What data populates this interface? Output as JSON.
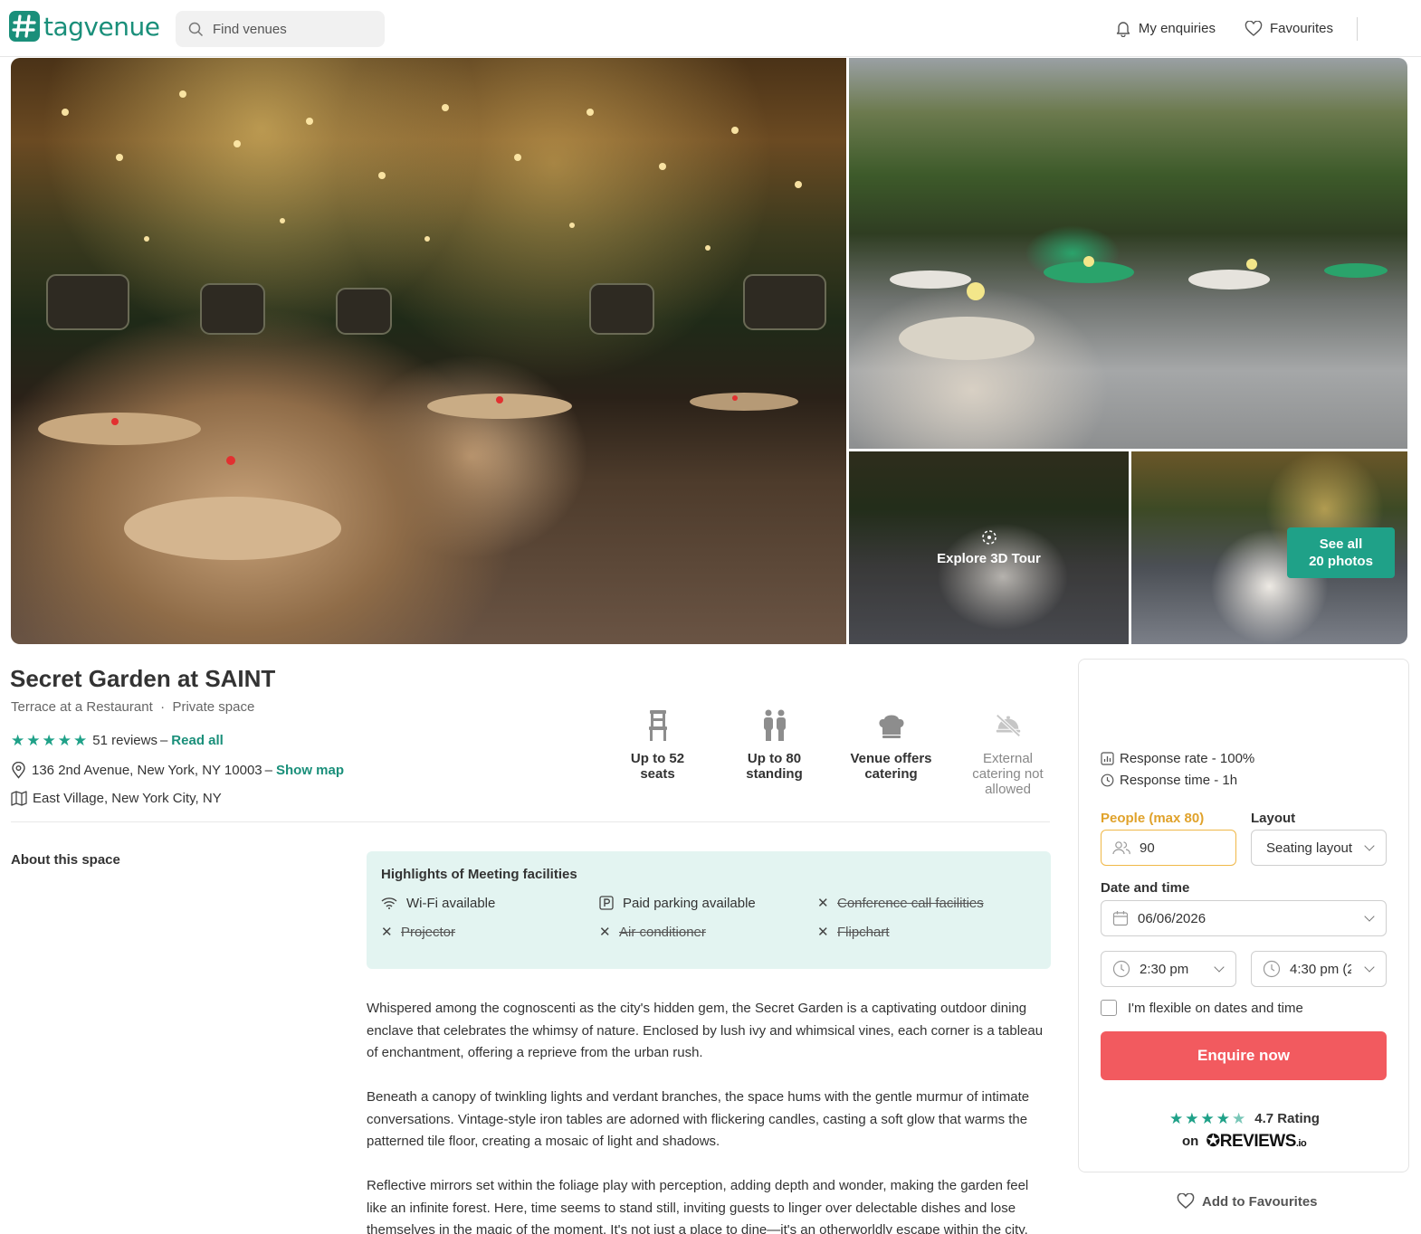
{
  "header": {
    "logo_text": "tagvenue",
    "search_placeholder": "Find venues",
    "nav": {
      "enquiries": "My enquiries",
      "favourites": "Favourites"
    }
  },
  "gallery": {
    "tour_label": "Explore 3D Tour",
    "see_all_line1": "See all",
    "see_all_line2": "20 photos"
  },
  "venue": {
    "title": "Secret Garden at SAINT",
    "type": "Terrace at a Restaurant",
    "space": "Private space",
    "rating_stars": 5,
    "reviews_count": "51 reviews",
    "reviews_sep": "–",
    "read_all": "Read all",
    "address": "136 2nd Avenue, New York, NY 10003",
    "address_sep": "–",
    "show_map": "Show map",
    "area": "East Village, New York City, NY"
  },
  "features": [
    {
      "icon": "chair-icon",
      "line1": "Up to 52",
      "line2": "seats",
      "line3": ""
    },
    {
      "icon": "standing-people-icon",
      "line1": "Up to 80",
      "line2": "standing",
      "line3": ""
    },
    {
      "icon": "chef-hat-icon",
      "line1": "Venue offers",
      "line2": "catering",
      "line3": ""
    },
    {
      "icon": "no-catering-icon",
      "line1": "External",
      "line2": "catering not",
      "line3": "allowed"
    }
  ],
  "about_label": "About this space",
  "highlights": {
    "title": "Highlights of Meeting facilities",
    "items": [
      {
        "label": "Wi-Fi available",
        "available": true,
        "icon": "wifi-icon"
      },
      {
        "label": "Paid parking available",
        "available": true,
        "icon": "parking-icon"
      },
      {
        "label": "Conference call facilities",
        "available": false,
        "icon": "x-icon"
      },
      {
        "label": "Projector",
        "available": false,
        "icon": "x-icon"
      },
      {
        "label": "Air conditioner",
        "available": false,
        "icon": "x-icon"
      },
      {
        "label": "Flipchart",
        "available": false,
        "icon": "x-icon"
      }
    ]
  },
  "description": {
    "p1": "Whispered among the cognoscenti as the city's hidden gem, the Secret Garden is a captivating outdoor dining enclave that celebrates the whimsy of nature. Enclosed by lush ivy and whimsical vines, each corner is a tableau of enchantment, offering a reprieve from the urban rush.",
    "p2": "Beneath a canopy of twinkling lights and verdant branches, the space hums with the gentle murmur of intimate conversations. Vintage-style iron tables are adorned with flickering candles, casting a soft glow that warms the patterned tile floor, creating a mosaic of light and shadows.",
    "p3": "Reflective mirrors set within the foliage play with perception, adding depth and wonder, making the garden feel like an infinite forest. Here, time seems to stand still, inviting guests to linger over delectable dishes and lose themselves in the magic of the moment. It's not just a place to dine—it's an otherworldly escape within the city."
  },
  "booking": {
    "response_rate": "Response rate - 100%",
    "response_time": "Response time - 1h",
    "people_label": "People (max 80)",
    "people_value": "90",
    "layout_label": "Layout",
    "layout_value": "Seating layout",
    "datetime_label": "Date and time",
    "date_value": "06/06/2026",
    "start_time": "2:30 pm",
    "end_time": "4:30 pm (2",
    "flexible_label": "I'm flexible on dates and time",
    "enquire_label": "Enquire now",
    "rating_text": "4.7 Rating",
    "rating_value": 4.7,
    "on_text": "on",
    "reviews_brand": "REVIEWS",
    "reviews_brand_suffix": ".io",
    "add_favourites": "Add to Favourites"
  },
  "colors": {
    "brand_teal": "#1a8f7a",
    "cta_red": "#f25a5f",
    "highlight_bg": "#e3f4f1",
    "people_label": "#e0a22b"
  }
}
